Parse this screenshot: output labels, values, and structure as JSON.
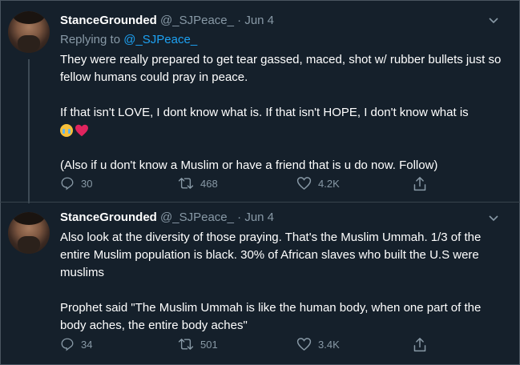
{
  "tweets": [
    {
      "name": "StanceGrounded",
      "handle": "@_SJPeace_",
      "separator": "·",
      "date": "Jun 4",
      "replying_prefix": "Replying to",
      "replying_mention": "@_SJPeace_",
      "text_p1": "They were really prepared to get tear gassed, maced, shot w/ rubber bullets just so fellow humans could pray in peace.",
      "text_p2": "If that isn't LOVE, I dont know what is. If that isn't HOPE, I don't know what is",
      "emojis": [
        "loudly-crying-face-emoji",
        "red-heart-emoji"
      ],
      "text_p3": "(Also if u don't know a Muslim or have a friend that is u do now. Follow)",
      "replies": "30",
      "retweets": "468",
      "likes": "4.2K"
    },
    {
      "name": "StanceGrounded",
      "handle": "@_SJPeace_",
      "separator": "·",
      "date": "Jun 4",
      "text_p1": "Also look at the diversity of those praying. That's the Muslim Ummah. 1/3 of the entire Muslim population is black. 30% of African slaves who built the U.S were muslims",
      "text_p2": "Prophet said \"The Muslim Ummah is like the human body, when one part of the body aches, the entire body aches\"",
      "replies": "34",
      "retweets": "501",
      "likes": "3.4K"
    }
  ],
  "colors": {
    "background": "#15202b",
    "secondary_text": "#8899a6",
    "link": "#1da1f2",
    "divider": "#38444d"
  }
}
